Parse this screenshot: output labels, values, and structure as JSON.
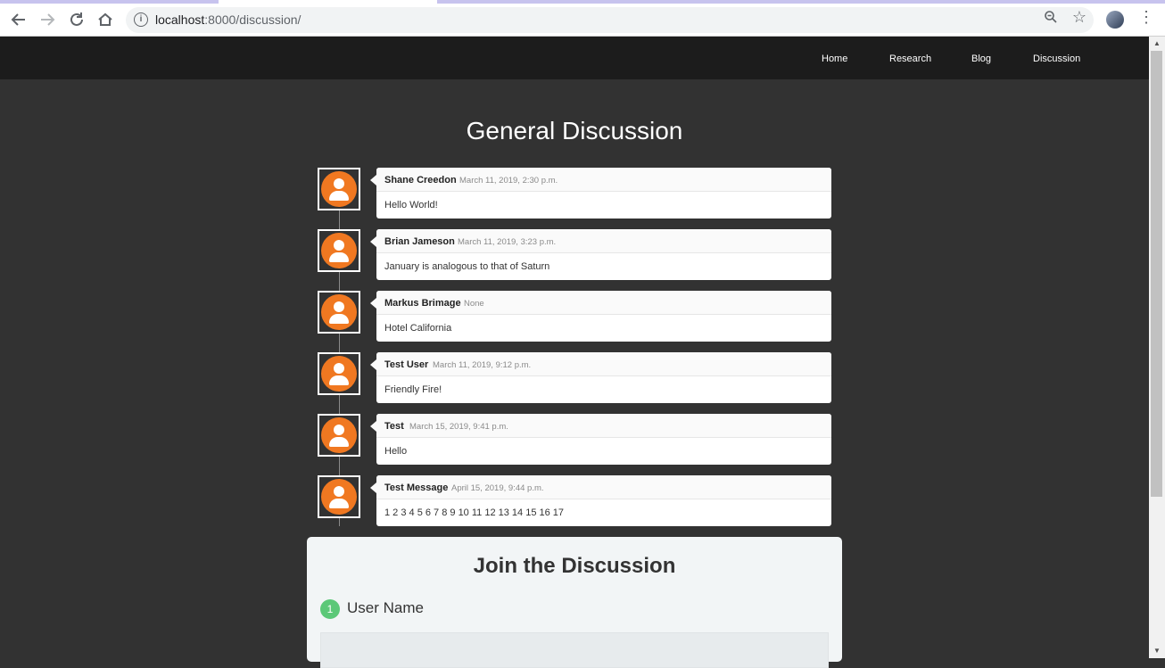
{
  "browser": {
    "url_host": "localhost",
    "url_rest": ":8000/discussion/",
    "back_icon": "arrow-left",
    "forward_icon": "arrow-right",
    "reload_icon": "reload",
    "home_icon": "home",
    "info_icon": "info",
    "zoom_icon": "magnifier",
    "star_icon": "star",
    "menu_icon": "kebab"
  },
  "nav": {
    "home": "Home",
    "research": "Research",
    "blog": "Blog",
    "discussion": "Discussion"
  },
  "page_title": "General Discussion",
  "comments": [
    {
      "author": "Shane Creedon",
      "time": "March 11, 2019, 2:30 p.m.",
      "body": "Hello World!"
    },
    {
      "author": "Brian Jameson",
      "time": "March 11, 2019, 3:23 p.m.",
      "body": "January is analogous to that of Saturn"
    },
    {
      "author": "Markus Brimage",
      "time": "None",
      "body": "Hotel California"
    },
    {
      "author": "Test User",
      "time": "March 11, 2019, 9:12 p.m.",
      "body": "Friendly Fire!"
    },
    {
      "author": "Test",
      "time": "March 15, 2019, 9:41 p.m.",
      "body": "Hello"
    },
    {
      "author": "Test Message",
      "time": "April 15, 2019, 9:44 p.m.",
      "body": "1 2 3 4 5 6 7 8 9 10 11 12 13 14 15 16 17"
    }
  ],
  "join": {
    "title": "Join the Discussion",
    "step_number": "1",
    "step_label": "User Name"
  },
  "colors": {
    "avatar": "#f07821",
    "step_badge": "#5cc878",
    "page_bg": "#323232",
    "navbar_bg": "#1c1c1c"
  }
}
